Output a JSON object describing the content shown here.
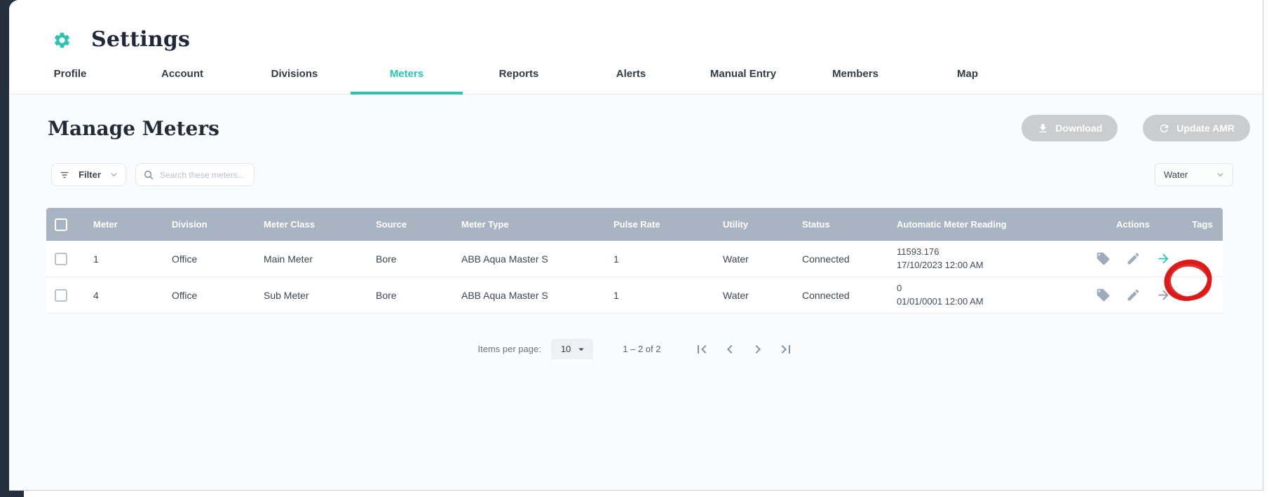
{
  "colors": {
    "accent_teal": "#2bc4b2",
    "table_header_bg": "#a9b4c3",
    "annotation_red": "#dc1a17",
    "edge_navy": "#25303f"
  },
  "header": {
    "title": "Settings"
  },
  "tabs": [
    {
      "label": "Profile"
    },
    {
      "label": "Account"
    },
    {
      "label": "Divisions"
    },
    {
      "label": "Meters"
    },
    {
      "label": "Reports"
    },
    {
      "label": "Alerts"
    },
    {
      "label": "Manual Entry"
    },
    {
      "label": "Members"
    },
    {
      "label": "Map"
    }
  ],
  "active_tab": "Meters",
  "page": {
    "title": "Manage Meters",
    "buttons": {
      "download": "Download",
      "update_amr": "Update AMR"
    }
  },
  "toolbar": {
    "filter_label": "Filter",
    "search_placeholder": "Search these meters...",
    "utility_select_value": "Water"
  },
  "table": {
    "columns": [
      "Meter",
      "Division",
      "Meter Class",
      "Source",
      "Meter Type",
      "Pulse Rate",
      "Utility",
      "Status",
      "Automatic Meter Reading",
      "Actions",
      "Tags"
    ],
    "rows": [
      {
        "meter": "1",
        "division": "Office",
        "meter_class": "Main Meter",
        "source": "Bore",
        "meter_type": "ABB Aqua Master S",
        "pulse_rate": "1",
        "utility": "Water",
        "status": "Connected",
        "amr_reading": "11593.176",
        "amr_timestamp": "17/10/2023 12:00 AM",
        "tags": ""
      },
      {
        "meter": "4",
        "division": "Office",
        "meter_class": "Sub Meter",
        "source": "Bore",
        "meter_type": "ABB Aqua Master S",
        "pulse_rate": "1",
        "utility": "Water",
        "status": "Connected",
        "amr_reading": "0",
        "amr_timestamp": "01/01/0001 12:00 AM",
        "tags": ""
      }
    ],
    "row_actions": [
      "tag",
      "edit",
      "details"
    ]
  },
  "pagination": {
    "items_per_page_label": "Items per page:",
    "items_per_page_value": "10",
    "range_label": "1 – 2 of 2"
  },
  "annotation": {
    "type": "hand-drawn-circle",
    "target": "row 1 details arrow",
    "color": "#dc1a17"
  },
  "icons": {
    "gear": "settings-gear",
    "filter": "filter-lines",
    "search": "magnifier",
    "chevron_down": "caret-down",
    "download": "arrow-down-to-line",
    "update_amr": "refresh-arrow",
    "tag": "price-tag",
    "edit": "pencil",
    "details": "arrow-right",
    "first_page": "bar-chevron-left",
    "prev_page": "chevron-left",
    "next_page": "chevron-right",
    "last_page": "bar-chevron-right"
  }
}
